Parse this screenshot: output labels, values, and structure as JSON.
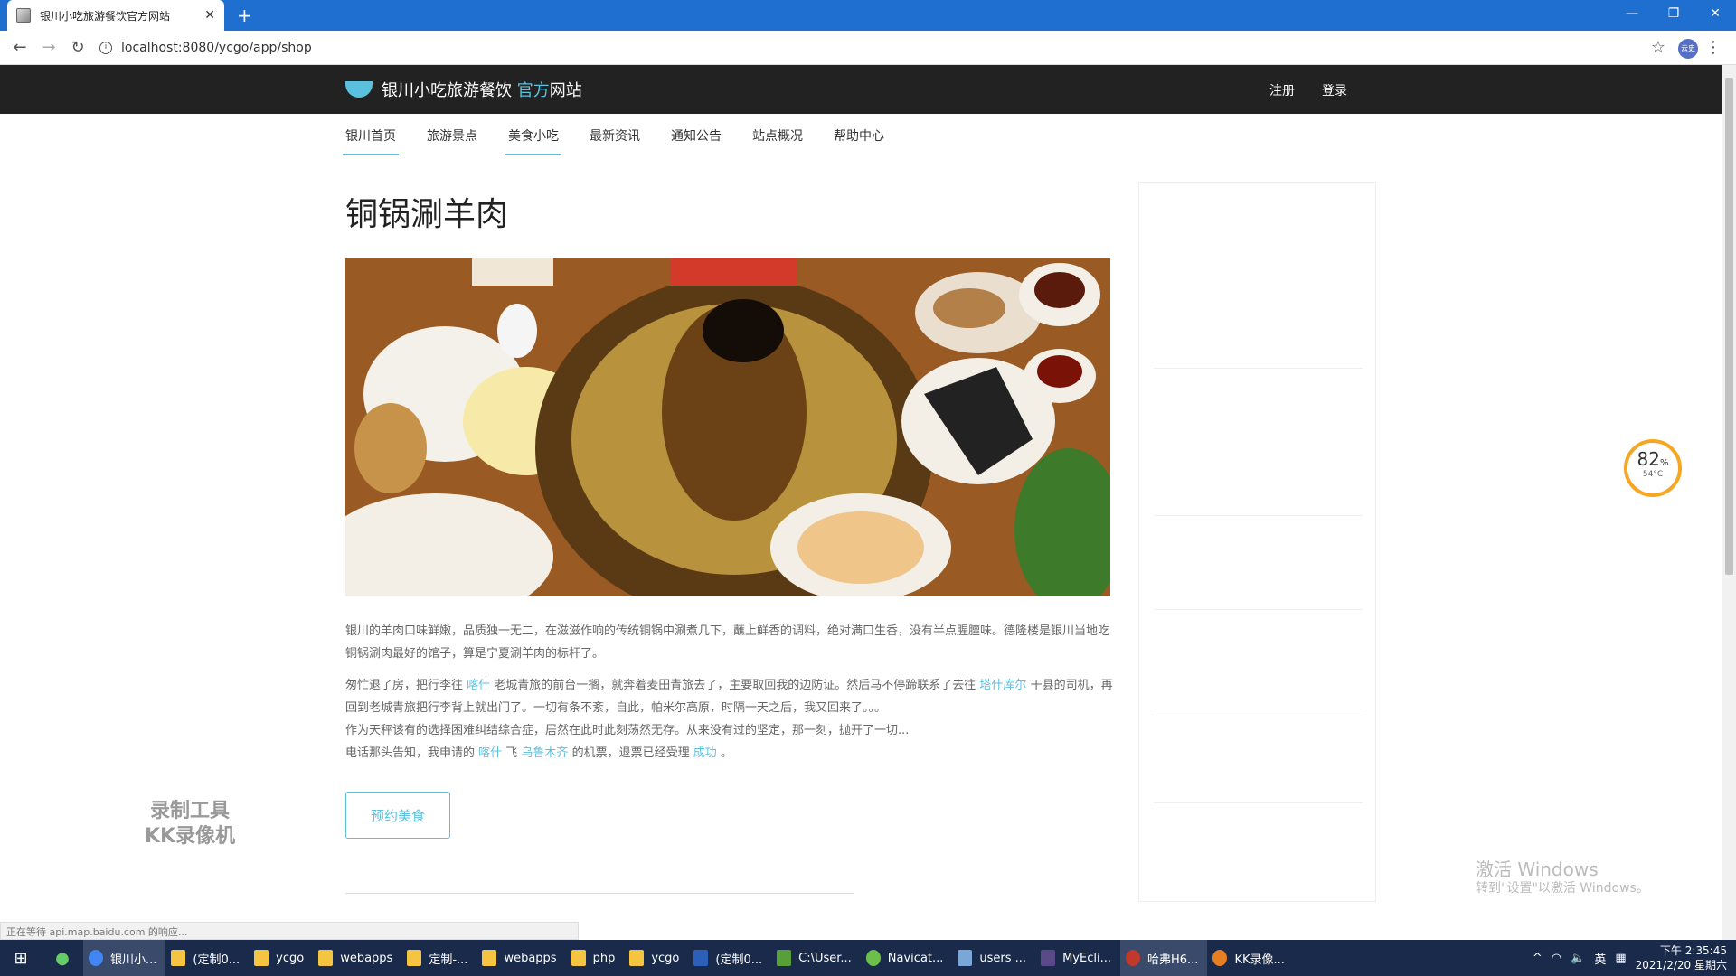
{
  "browser": {
    "tab_title": "银川小吃旅游餐饮官方网站",
    "new_tab": "+",
    "url": "localhost:8080/ycgo/app/shop",
    "profile_label": "云史"
  },
  "site": {
    "logo_text": "银川小吃旅游餐饮 ",
    "logo_accent": "官方",
    "logo_tail": "网站",
    "register": "注册",
    "login": "登录",
    "nav": [
      {
        "label": "银川首页"
      },
      {
        "label": "旅游景点"
      },
      {
        "label": "美食小吃"
      },
      {
        "label": "最新资讯"
      },
      {
        "label": "通知公告"
      },
      {
        "label": "站点概况"
      },
      {
        "label": "帮助中心"
      }
    ]
  },
  "article": {
    "title": "铜锅涮羊肉",
    "p1": "银川的羊肉口味鲜嫩，品质独一无二，在滋滋作响的传统铜锅中涮煮几下，蘸上鲜香的调料，绝对满口生香，没有半点腥膻味。德隆楼是银川当地吃铜锅涮肉最好的馆子，算是宁夏涮羊肉的标杆了。",
    "p2a": "匆忙退了房，把行李往 ",
    "p2_link1": "喀什",
    "p2b": " 老城青旅的前台一搁，就奔着麦田青旅去了，主要取回我的边防证。然后马不停蹄联系了去往 ",
    "p2_link2": "塔什库尔",
    "p2c": " 干县的司机，再回到老城青旅把行李背上就出门了。一切有条不紊，自此，帕米尔高原，时隔一天之后，我又回来了。。。",
    "p3": "作为天秤该有的选择困难纠结综合症，居然在此时此刻荡然无存。从来没有过的坚定，那一刻，抛开了一切...",
    "p4a": "电话那头告知，我申请的 ",
    "p4_link1": "喀什",
    "p4b": " 飞 ",
    "p4_link2": "乌鲁木齐",
    "p4c": " 的机票，退票已经受理 ",
    "p4_link3": "成功",
    "p4d": " 。",
    "book_button": "预约美食"
  },
  "overlays": {
    "gauge_value": "82",
    "gauge_unit": "%",
    "gauge_temp": "54°C",
    "recorder_line1": "录制工具",
    "recorder_line2": "KK录像机",
    "activate_title": "激活 Windows",
    "activate_sub": "转到\"设置\"以激活 Windows。",
    "status_text": "正在等待 api.map.baidu.com 的响应..."
  },
  "taskbar": {
    "items": [
      {
        "label": "银川小..."
      },
      {
        "label": "(定制0..."
      },
      {
        "label": "ycgo"
      },
      {
        "label": "webapps"
      },
      {
        "label": "定制-..."
      },
      {
        "label": "webapps"
      },
      {
        "label": "php"
      },
      {
        "label": "ycgo"
      },
      {
        "label": "(定制0..."
      },
      {
        "label": "C:\\User..."
      },
      {
        "label": "Navicat..."
      },
      {
        "label": "users ..."
      },
      {
        "label": "MyEcli..."
      },
      {
        "label": "哈弗H6..."
      },
      {
        "label": "KK录像..."
      }
    ],
    "ime": "英",
    "time": "下午 2:35:45",
    "date": "2021/2/20 星期六"
  },
  "colors": {
    "accent": "#5bc0de",
    "header_bg": "#222222",
    "taskbar_bg": "#1a2a4a",
    "tabbar_bg": "#1e6fd0"
  }
}
